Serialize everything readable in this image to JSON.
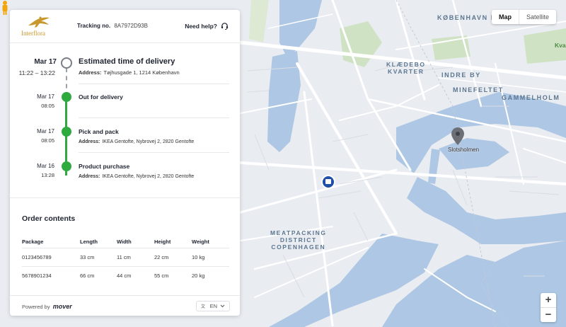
{
  "header": {
    "logo_text": "Interflora",
    "tracking_label": "Tracking no.",
    "tracking_number": "8A7972D93B",
    "help_label": "Need help?"
  },
  "timeline": {
    "eta": {
      "date": "Mar 17",
      "time": "11:22 – 13:22",
      "title": "Estimated time of delivery",
      "address_label": "Address:",
      "address": "Tøjhusgade 1, 1214 København"
    },
    "events": [
      {
        "date": "Mar 17",
        "time": "08:05",
        "title": "Out for delivery"
      },
      {
        "date": "Mar 17",
        "time": "08:05",
        "title": "Pick and pack",
        "address_label": "Address:",
        "address": "IKEA Gentofte, Nybrovej 2, 2820 Gentofte"
      },
      {
        "date": "Mar 16",
        "time": "13:28",
        "title": "Product purchase",
        "address_label": "Address:",
        "address": "IKEA Gentofte, Nybrovej 2, 2820 Gentofte"
      }
    ]
  },
  "order": {
    "title": "Order contents",
    "columns": [
      "Package",
      "Length",
      "Width",
      "Height",
      "Weight"
    ],
    "rows": [
      [
        "0123456789",
        "33 cm",
        "11 cm",
        "22 cm",
        "10 kg"
      ],
      [
        "5678901234",
        "66 cm",
        "44 cm",
        "55 cm",
        "20 kg"
      ]
    ]
  },
  "footer": {
    "powered_label": "Powered by",
    "brand": "mover",
    "language": "EN"
  },
  "map": {
    "toggle": {
      "map": "Map",
      "satellite": "Satellite"
    },
    "labels": {
      "kobenhavn_k": "KØBENHAVN K",
      "klaedebo_1": "KLÆDEBO",
      "klaedebo_2": "KVARTER",
      "indre_by": "INDRE BY",
      "minefeltet": "MINEFELTET",
      "gammelholm": "GAMMELHOLM",
      "meat_1": "MEATPACKING",
      "meat_2": "DISTRICT",
      "meat_3": "COPENHAGEN",
      "kva": "Kva"
    },
    "pin_label": "Slotsholmen",
    "zoom_in": "+",
    "zoom_out": "−"
  },
  "colors": {
    "accent_green": "#2eaa3f",
    "water": "#aec7e4",
    "park": "#cfe3c4",
    "map_base": "#e9ecf1",
    "logo_gold": "#c8982e"
  }
}
